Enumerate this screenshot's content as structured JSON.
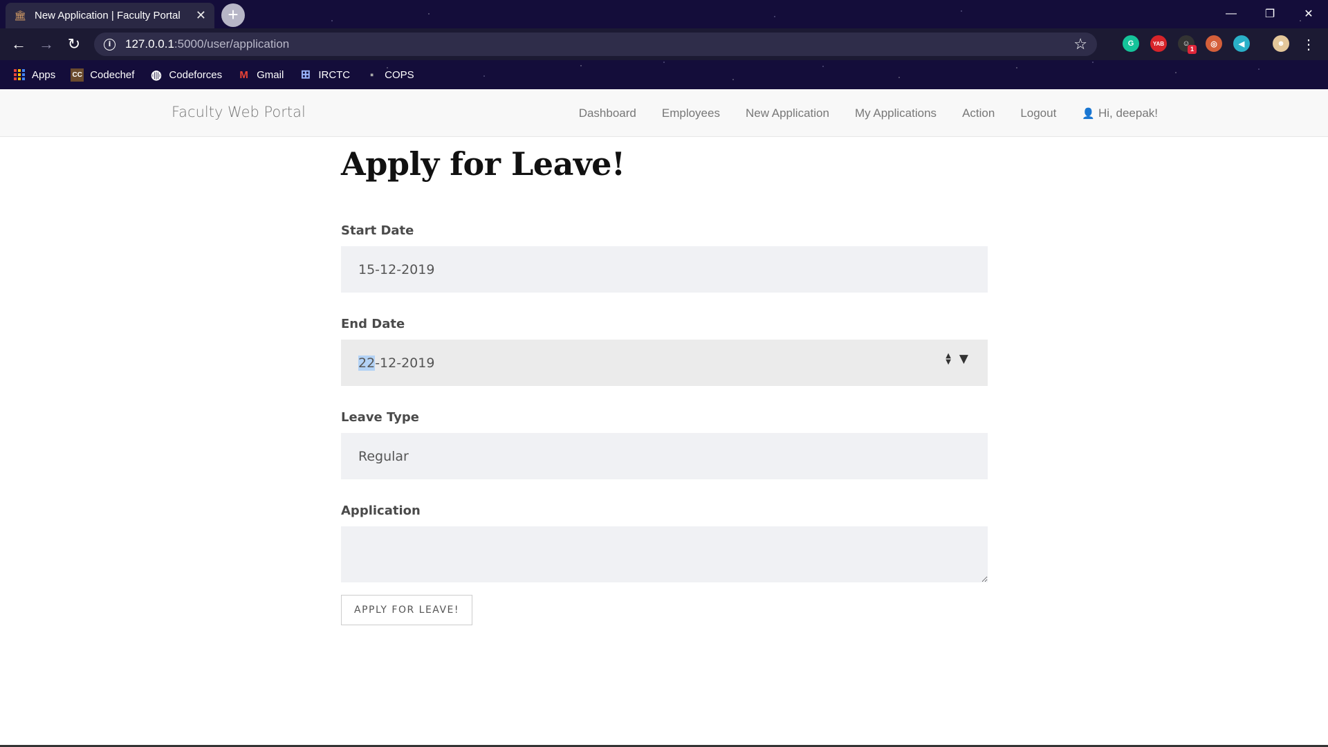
{
  "browser": {
    "tab_title": "New Application | Faculty Portal",
    "tab_close": "✕",
    "new_tab": "+",
    "url_host": "127.0.0.1",
    "url_path": ":5000/user/application",
    "window_controls": {
      "minimize": "—",
      "restore": "❐",
      "close": "✕"
    },
    "extensions": [
      {
        "name": "grammarly-icon",
        "label": "G",
        "color": "#15c39a"
      },
      {
        "name": "yab-icon",
        "label": "YAB",
        "color": "#d8242a"
      },
      {
        "name": "ghost-extension-icon",
        "label": "☺",
        "color": "#333333",
        "badge": "1"
      },
      {
        "name": "glasses-extension-icon",
        "label": "◎",
        "color": "#d45f3a"
      },
      {
        "name": "speaker-extension-icon",
        "label": "◀",
        "color": "#2ab0c8"
      },
      {
        "name": "profile-avatar-icon",
        "label": "☻",
        "color": "#e4c79a"
      }
    ],
    "bookmarks": [
      {
        "name": "bookmark-apps",
        "label": "Apps",
        "icon": "apps-grid-icon"
      },
      {
        "name": "bookmark-codechef",
        "label": "Codechef",
        "icon": "codechef-icon",
        "glyph": "CC"
      },
      {
        "name": "bookmark-codeforces",
        "label": "Codeforces",
        "icon": "globe-icon",
        "glyph": "◍"
      },
      {
        "name": "bookmark-gmail",
        "label": "Gmail",
        "icon": "gmail-icon",
        "glyph": "M"
      },
      {
        "name": "bookmark-irctc",
        "label": "IRCTC",
        "icon": "irctc-icon",
        "glyph": "⊞"
      },
      {
        "name": "bookmark-cops",
        "label": "COPS",
        "icon": "cops-icon",
        "glyph": "▪"
      }
    ]
  },
  "navbar": {
    "brand": "Faculty Web Portal",
    "links": [
      "Dashboard",
      "Employees",
      "New Application",
      "My Applications",
      "Action",
      "Logout"
    ],
    "greeting": "Hi, deepak!"
  },
  "form": {
    "title": "Apply for Leave!",
    "start_date_label": "Start Date",
    "start_date_value": "15-12-2019",
    "end_date_label": "End Date",
    "end_date_selected_segment": "22",
    "end_date_rest": "-12-2019",
    "leave_type_label": "Leave Type",
    "leave_type_value": "Regular",
    "application_label": "Application",
    "application_value": "",
    "submit_label": "APPLY FOR LEAVE!"
  }
}
